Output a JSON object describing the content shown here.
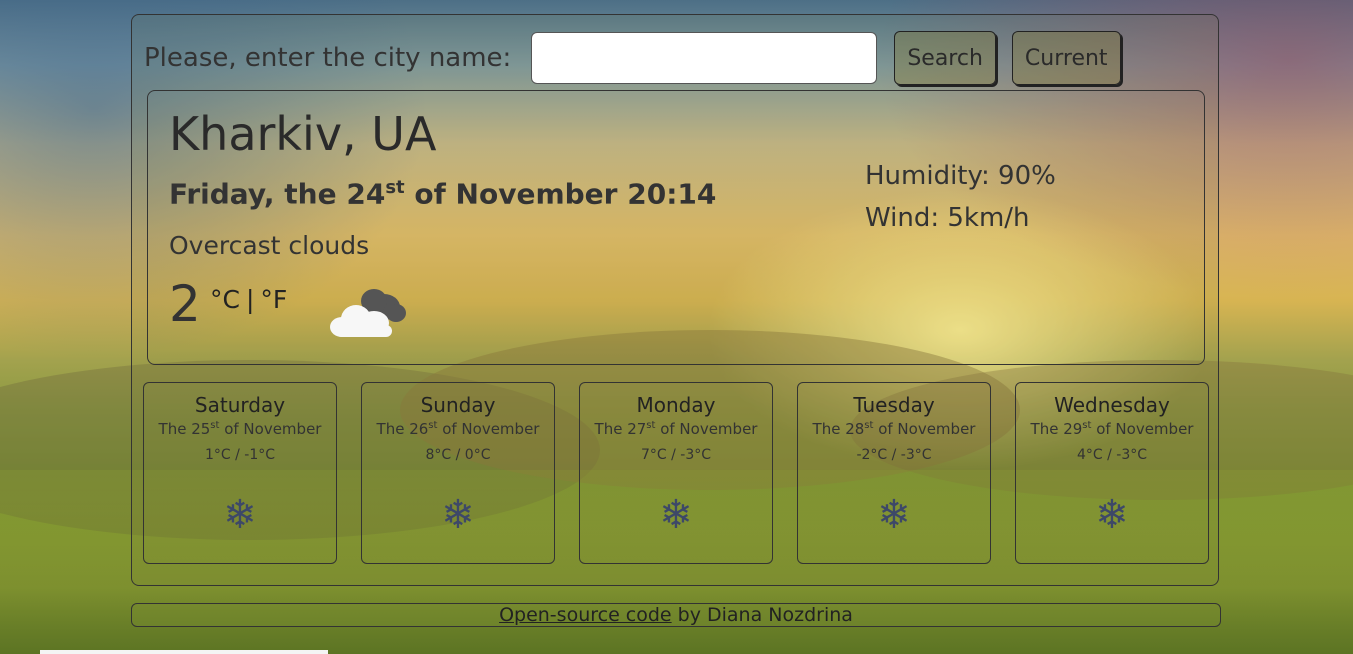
{
  "search": {
    "label": "Please, enter the city name:",
    "value": "",
    "placeholder": "",
    "search_button": "Search",
    "current_button": "Current"
  },
  "current": {
    "city": "Kharkiv, UA",
    "date_prefix": "Friday, the 24",
    "date_suffix": "st",
    "date_rest": " of November 20:14",
    "description": "Overcast clouds",
    "temperature": "2",
    "unit_c": "°C",
    "unit_sep": "|",
    "unit_f": "°F",
    "icon": "cloud-icon",
    "humidity": "Humidity: 90%",
    "wind": "Wind: 5km/h"
  },
  "forecast": [
    {
      "day": "Saturday",
      "date_prefix": "The 25",
      "date_suffix": "st",
      "date_rest": " of November",
      "temp": "1°C / -1°C",
      "icon": "snowflake-icon"
    },
    {
      "day": "Sunday",
      "date_prefix": "The 26",
      "date_suffix": "st",
      "date_rest": " of November",
      "temp": "8°C / 0°C",
      "icon": "snowflake-icon"
    },
    {
      "day": "Monday",
      "date_prefix": "The 27",
      "date_suffix": "st",
      "date_rest": " of November",
      "temp": "7°C / -3°C",
      "icon": "snowflake-icon"
    },
    {
      "day": "Tuesday",
      "date_prefix": "The 28",
      "date_suffix": "st",
      "date_rest": " of November",
      "temp": "-2°C / -3°C",
      "icon": "snowflake-icon"
    },
    {
      "day": "Wednesday",
      "date_prefix": "The 29",
      "date_suffix": "st",
      "date_rest": " of November",
      "temp": "4°C / -3°C",
      "icon": "snowflake-icon"
    }
  ],
  "footer": {
    "link_text": "Open-source code",
    "rest": " by Diana Nozdrina"
  }
}
